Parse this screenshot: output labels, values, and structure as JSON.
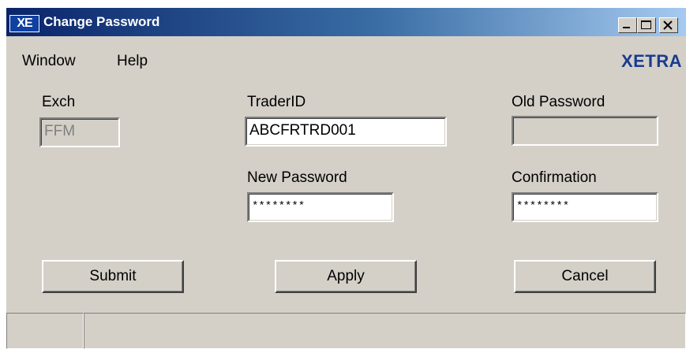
{
  "window": {
    "title": "Change Password",
    "app_icon_text": "XE",
    "controls": [
      "minimize-icon",
      "maximize-icon",
      "close-icon"
    ]
  },
  "menu": {
    "window_label": "Window",
    "help_label": "Help"
  },
  "brand": "XETRA",
  "form": {
    "exch": {
      "label": "Exch",
      "value": "FFM"
    },
    "trader_id": {
      "label": "TraderID",
      "value": "ABCFRTRD001"
    },
    "old_password": {
      "label": "Old Password",
      "value": ""
    },
    "new_password": {
      "label": "New Password",
      "value": "********"
    },
    "confirmation": {
      "label": "Confirmation",
      "value": "********"
    }
  },
  "buttons": {
    "submit": "Submit",
    "apply": "Apply",
    "cancel": "Cancel"
  },
  "status": [
    "",
    ""
  ],
  "colors": {
    "titlebar_start": "#0a246a",
    "titlebar_end": "#a6caf0",
    "face": "#d4d0c8",
    "brand": "#1a3b8f"
  }
}
